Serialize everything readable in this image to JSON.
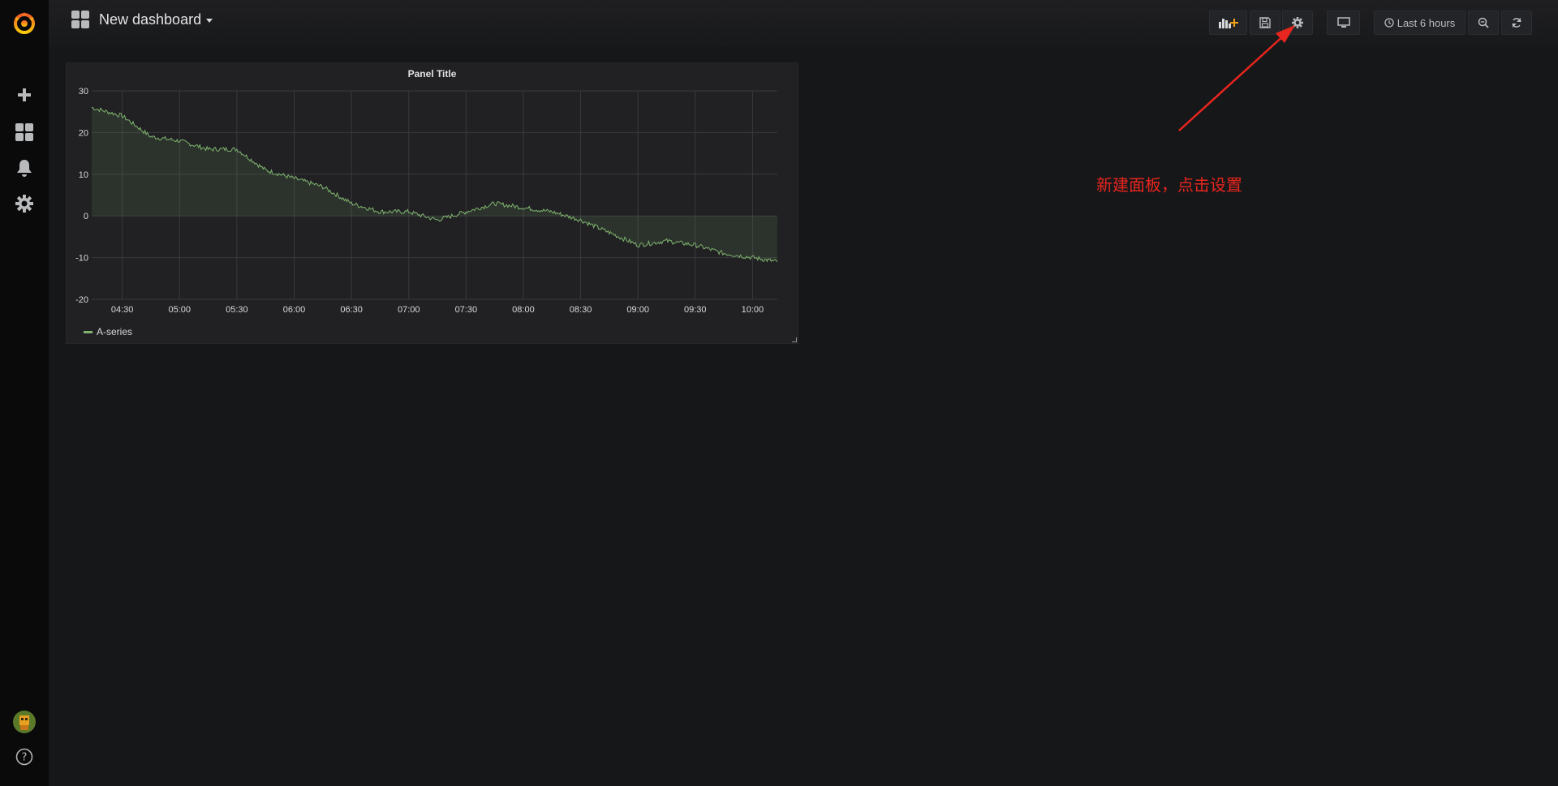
{
  "dashboard": {
    "title": "New dashboard"
  },
  "toolbar": {
    "time_range_label": "Last 6 hours"
  },
  "panel": {
    "title": "Panel Title"
  },
  "annotation": {
    "text": "新建面板，点击设置",
    "color": "#e8251e"
  },
  "chart_data": {
    "type": "area",
    "title": "Panel Title",
    "ylim": [
      -20,
      30
    ],
    "yticks": [
      "30",
      "20",
      "10",
      "0",
      "-10",
      "-20"
    ],
    "xticks": [
      "04:30",
      "05:00",
      "05:30",
      "06:00",
      "06:30",
      "07:00",
      "07:30",
      "08:00",
      "08:30",
      "09:00",
      "09:30",
      "10:00"
    ],
    "series": [
      {
        "name": "A-series",
        "color": "#7eb26d",
        "x": [
          "04:14",
          "04:30",
          "04:45",
          "05:00",
          "05:15",
          "05:30",
          "05:45",
          "06:00",
          "06:15",
          "06:30",
          "06:45",
          "07:00",
          "07:15",
          "07:30",
          "07:45",
          "08:00",
          "08:15",
          "08:30",
          "08:45",
          "09:00",
          "09:15",
          "09:30",
          "09:45",
          "10:00",
          "10:13"
        ],
        "values": [
          26,
          24,
          19,
          18,
          16,
          16,
          11,
          9,
          7,
          3,
          1,
          1,
          -1,
          1,
          3,
          2,
          1,
          -1,
          -4,
          -7,
          -6,
          -7,
          -9,
          -10,
          -11
        ]
      }
    ],
    "grid": true,
    "legend": "bottom-left"
  },
  "icons": {
    "logo": "grafana-logo-icon",
    "create": "plus-icon",
    "dashboards": "dashboards-icon",
    "alerting": "bell-icon",
    "configuration": "gear-icon",
    "profile": "avatar",
    "help": "help-icon",
    "add_panel": "add-panel-icon",
    "save": "save-icon",
    "settings": "gear-icon",
    "tv": "monitor-icon",
    "clock": "clock-icon",
    "zoom": "zoom-out-icon",
    "refresh": "refresh-icon"
  }
}
